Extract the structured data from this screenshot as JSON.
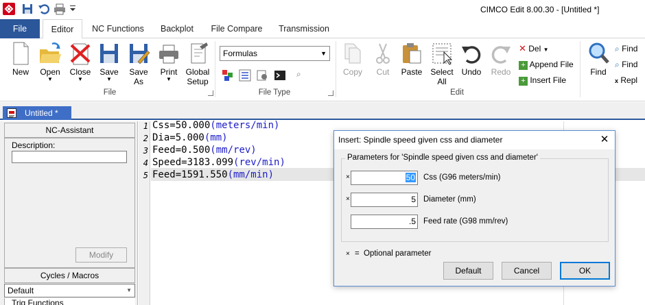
{
  "app": {
    "title": "CIMCO Edit 8.00.30 - [Untitled *]"
  },
  "ribbon": {
    "tabs": [
      "File",
      "Editor",
      "NC Functions",
      "Backplot",
      "File Compare",
      "Transmission"
    ],
    "groups": {
      "file": {
        "label": "File",
        "buttons": {
          "new": "New",
          "open": "Open",
          "close": "Close",
          "save": "Save",
          "save_as": "Save As",
          "print": "Print",
          "global_setup": "Global Setup"
        }
      },
      "file_type": {
        "label": "File Type",
        "dropdown_value": "Formulas"
      },
      "edit": {
        "label": "Edit",
        "buttons": {
          "copy": "Copy",
          "cut": "Cut",
          "paste": "Paste",
          "select_all": "Select All",
          "undo": "Undo",
          "redo": "Redo"
        },
        "small": {
          "del": "Del",
          "append_file": "Append File",
          "insert_file": "Insert File"
        }
      },
      "find": {
        "buttons": {
          "find": "Find"
        },
        "small": {
          "find1": "Find",
          "find2": "Find",
          "replace": "Repl"
        }
      }
    }
  },
  "document": {
    "tab_label": "Untitled *"
  },
  "nc_assistant": {
    "header": "NC-Assistant",
    "description_label": "Description:",
    "description_value": "",
    "modify_button": "Modify",
    "cycles_header": "Cycles / Macros",
    "cycles_select": "Default",
    "trig_label": "Trig Functions"
  },
  "editor": {
    "lines": [
      {
        "num": "1",
        "key": "Css=50.000",
        "unit": "(meters/min)"
      },
      {
        "num": "2",
        "key": "Dia=5.000",
        "unit": "(mm)"
      },
      {
        "num": "3",
        "key": "Feed=0.500",
        "unit": "(mm/rev)"
      },
      {
        "num": "4",
        "key": "Speed=3183.099",
        "unit": "(rev/min)"
      },
      {
        "num": "5",
        "key": "Feed=1591.550",
        "unit": "(mm/min)"
      }
    ]
  },
  "dialog": {
    "title": "Insert: Spindle speed given css and diameter",
    "group_label": "Parameters for 'Spindle speed given css and diameter'",
    "fields": [
      {
        "marker": "×",
        "value": "50",
        "label": "Css (G96 meters/min)"
      },
      {
        "marker": "×",
        "value": "5",
        "label": "Diameter (mm)"
      },
      {
        "marker": "",
        "value": ".5",
        "label": "Feed rate (G98 mm/rev)"
      }
    ],
    "legend": {
      "marker": "×",
      "eq": "=",
      "text": "Optional parameter"
    },
    "buttons": {
      "default": "Default",
      "cancel": "Cancel",
      "ok": "OK"
    }
  },
  "colors": {
    "accent": "#2b579a",
    "unit_text": "#1c1cc8",
    "doc_tab": "#3f6ec6",
    "selection": "#3399ff"
  }
}
